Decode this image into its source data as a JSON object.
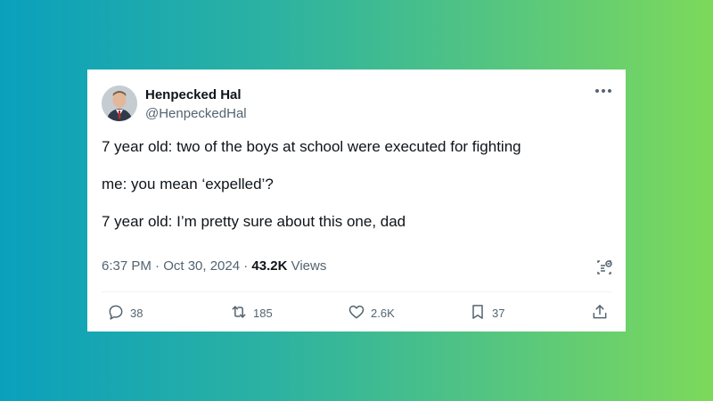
{
  "author": {
    "name": "Henpecked Hal",
    "handle": "@HenpeckedHal"
  },
  "tweet": {
    "lines": [
      "7 year old: two of the boys at school were executed for fighting",
      "me: you mean ‘expelled’?",
      "7 year old: I’m pretty sure about this one, dad"
    ]
  },
  "meta": {
    "timestamp": "6:37 PM · Oct 30, 2024 · ",
    "views_count": "43.2K",
    "views_label": " Views"
  },
  "actions": {
    "replies": "38",
    "reposts": "185",
    "likes": "2.6K",
    "bookmarks": "37"
  },
  "icons": {
    "more": "more-icon",
    "grok": "grok-icon",
    "reply": "reply-icon",
    "repost": "repost-icon",
    "like": "like-icon",
    "bookmark": "bookmark-icon",
    "share": "share-icon"
  },
  "colors": {
    "text_primary": "#0f1419",
    "text_secondary": "#536471"
  }
}
